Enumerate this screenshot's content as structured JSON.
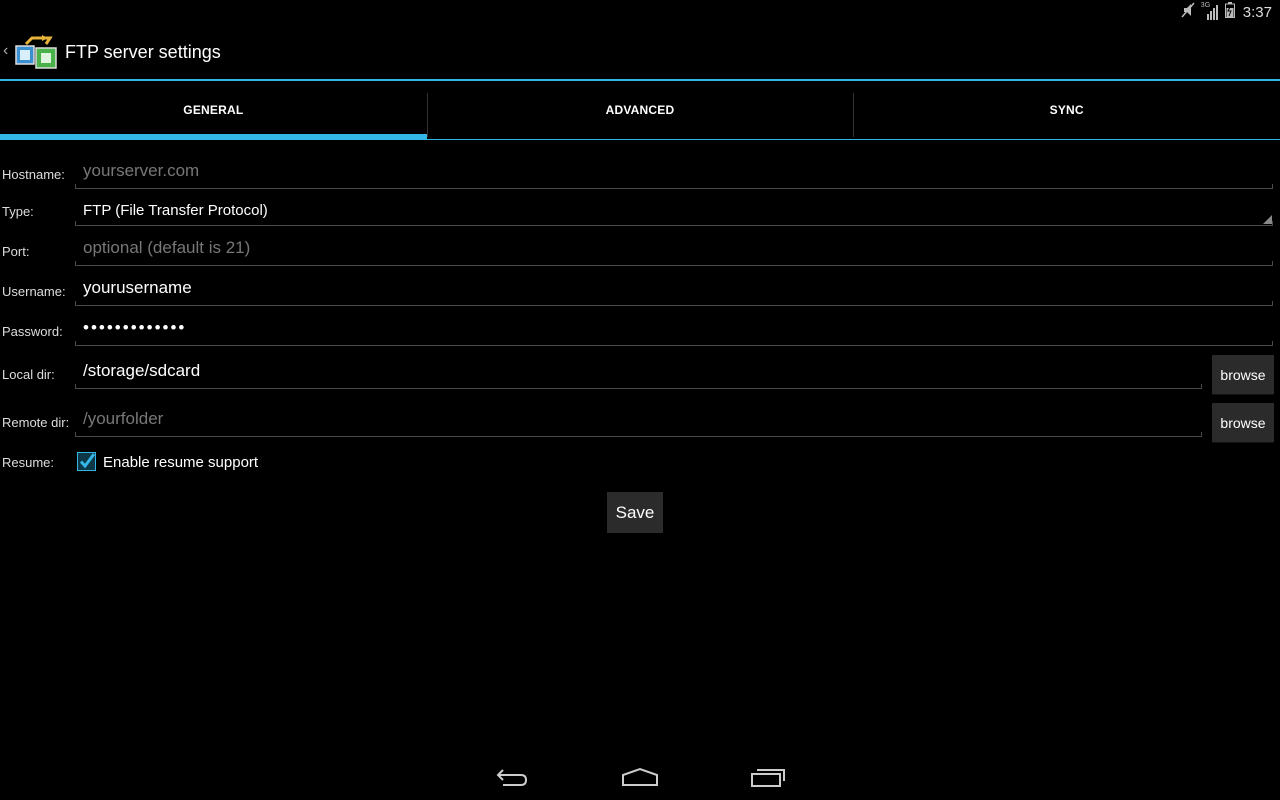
{
  "status_bar": {
    "time": "3:37",
    "network_label": "3G",
    "icons": [
      "mute-icon",
      "signal-icon",
      "battery-icon"
    ]
  },
  "action_bar": {
    "title": "FTP server settings",
    "app_icon": "ftp-folders-icon",
    "up_icon": "chevron-left-icon"
  },
  "tabs": [
    {
      "label": "GENERAL",
      "active": true
    },
    {
      "label": "ADVANCED",
      "active": false
    },
    {
      "label": "SYNC",
      "active": false
    }
  ],
  "form": {
    "hostname": {
      "label": "Hostname:",
      "value": "",
      "placeholder": "yourserver.com"
    },
    "type": {
      "label": "Type:",
      "value": "FTP (File Transfer Protocol)"
    },
    "port": {
      "label": "Port:",
      "value": "",
      "placeholder": "optional (default is 21)"
    },
    "username": {
      "label": "Username:",
      "value": "yourusername"
    },
    "password": {
      "label": "Password:",
      "masked_value": "•••••••••••••"
    },
    "local_dir": {
      "label": "Local dir:",
      "value": "/storage/sdcard",
      "browse_label": "browse"
    },
    "remote_dir": {
      "label": "Remote dir:",
      "value": "",
      "placeholder": "/yourfolder",
      "browse_label": "browse"
    },
    "resume": {
      "label": "Resume:",
      "checkbox_label": "Enable resume support",
      "checked": true
    }
  },
  "save_label": "Save",
  "nav_bar": [
    "back-icon",
    "home-icon",
    "recent-apps-icon"
  ],
  "colors": {
    "accent": "#33b5e5",
    "background": "#000000",
    "placeholder": "#777777"
  }
}
